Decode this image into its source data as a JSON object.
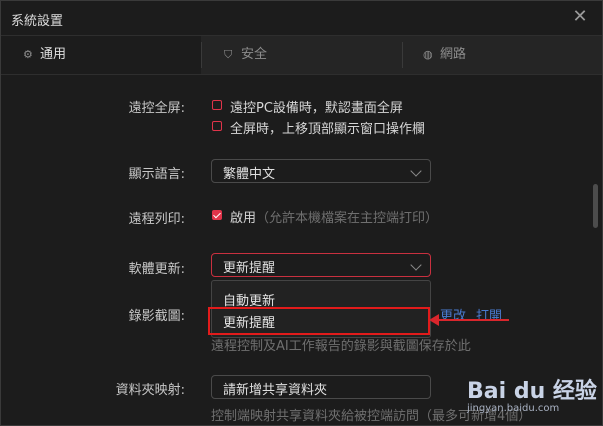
{
  "window": {
    "title": "系統設置"
  },
  "tabs": [
    {
      "label": "通用",
      "icon": "gear-icon",
      "active": true
    },
    {
      "label": "安全",
      "icon": "shield-icon",
      "active": false
    },
    {
      "label": "網路",
      "icon": "globe-icon",
      "active": false
    }
  ],
  "remote_fullscreen": {
    "label": "遠控全屏:",
    "options": [
      {
        "text": "遠控PC設備時，默認畫面全屏",
        "checked": false
      },
      {
        "text": "全屏時，上移頂部顯示窗口操作欄",
        "checked": false
      }
    ]
  },
  "language": {
    "label": "顯示語言:",
    "value": "繁體中文"
  },
  "remote_print": {
    "label": "遠程列印:",
    "checkbox_text": "啟用",
    "hint": "（允許本機檔案在主控端打印）",
    "checked": true
  },
  "software_update": {
    "label": "軟體更新:",
    "value": "更新提醒",
    "options": [
      "自動更新",
      "更新提醒"
    ]
  },
  "recording": {
    "label": "錄影截圖:",
    "change_link": "更改",
    "open_link": "打開",
    "desc": "遠程控制及AI工作報告的錄影與截圖保存於此"
  },
  "folder_mapping": {
    "label": "資料夾映射:",
    "placeholder": "請新增共享資料夾",
    "desc": "控制端映射共享資料夾給被控端訪問（最多可新增4個）"
  },
  "watermark": {
    "brand": "Bai du 经验",
    "url": "jingyan.baidu.com"
  },
  "colors": {
    "accent": "#e0344a",
    "link": "#4a7bd0",
    "highlight": "#e21b1b"
  }
}
